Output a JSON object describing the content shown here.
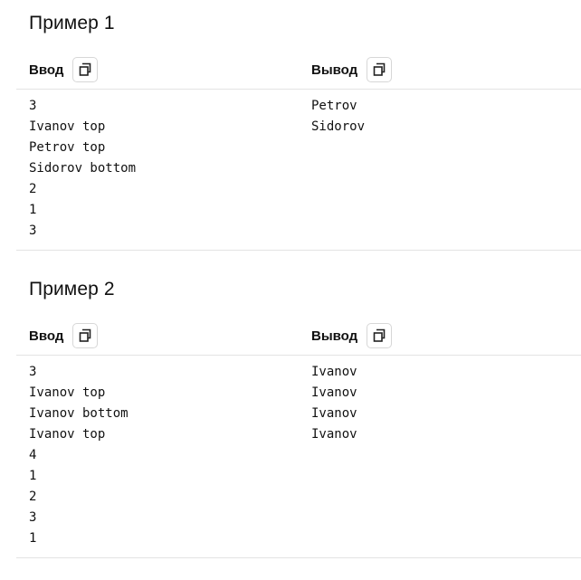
{
  "examples": [
    {
      "title": "Пример 1",
      "input_label": "Ввод",
      "output_label": "Вывод",
      "copy_icon": "copy-icon",
      "input_lines": [
        "3",
        "Ivanov top",
        "Petrov top",
        "Sidorov bottom",
        "2",
        "1",
        "3"
      ],
      "output_lines": [
        "Petrov",
        "Sidorov"
      ]
    },
    {
      "title": "Пример 2",
      "input_label": "Ввод",
      "output_label": "Вывод",
      "copy_icon": "copy-icon",
      "input_lines": [
        "3",
        "Ivanov top",
        "Ivanov bottom",
        "Ivanov top",
        "4",
        "1",
        "2",
        "3",
        "1"
      ],
      "output_lines": [
        "Ivanov",
        "Ivanov",
        "Ivanov",
        "Ivanov"
      ]
    }
  ]
}
